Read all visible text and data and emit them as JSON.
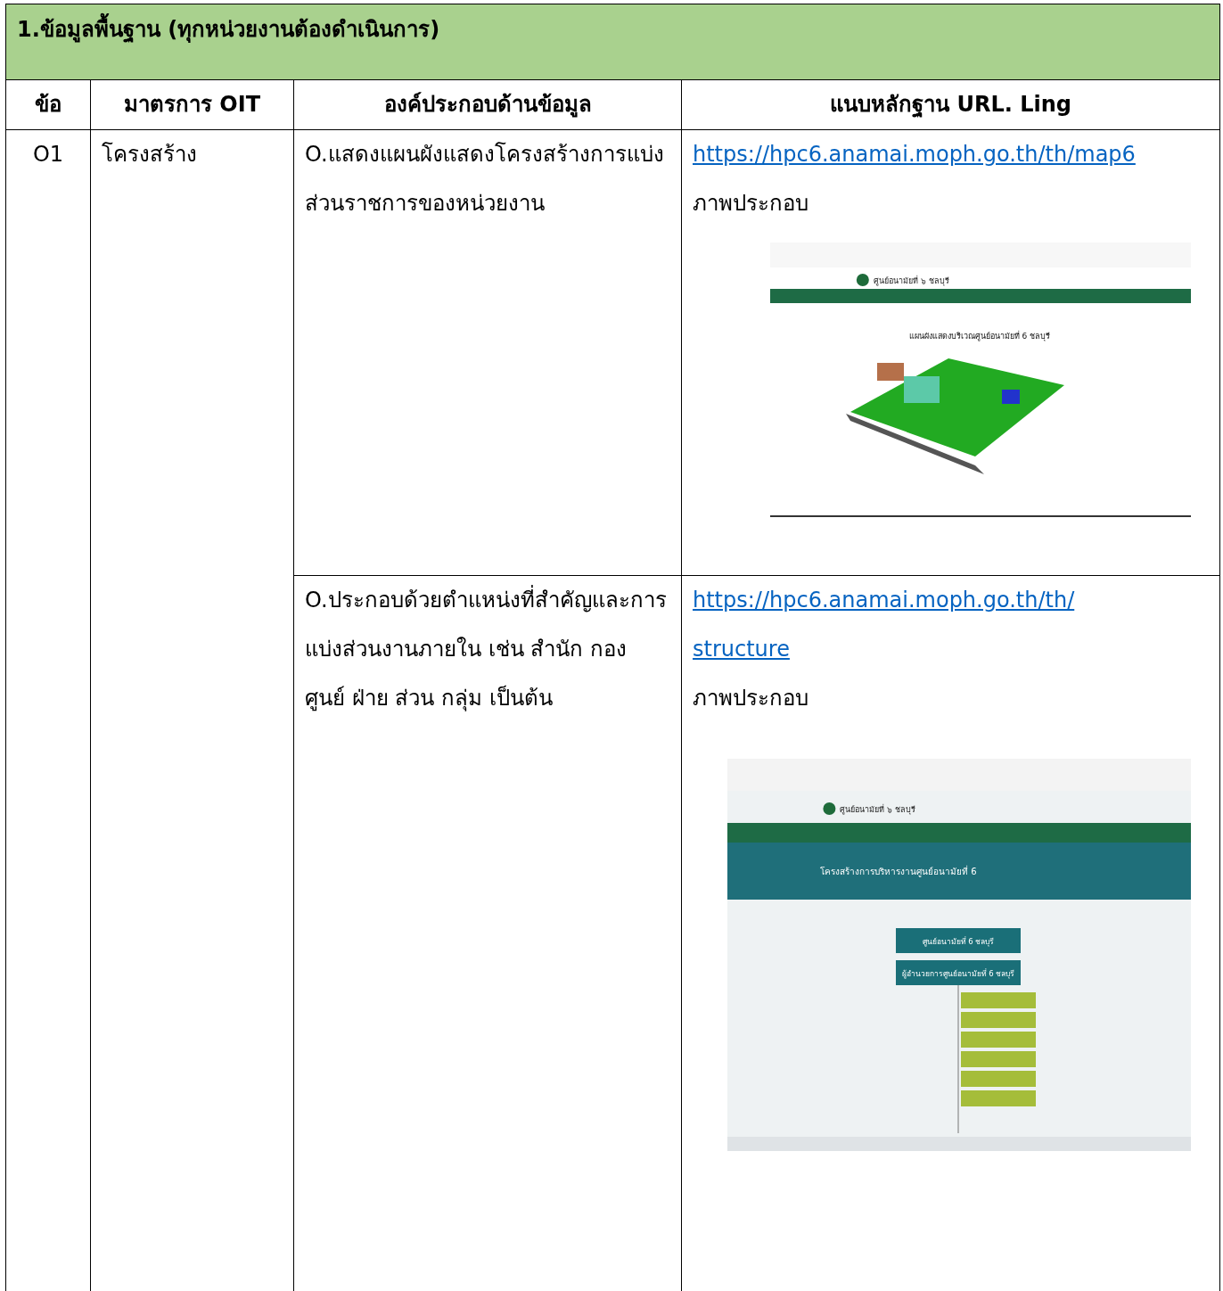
{
  "section_title": "1.ข้อมูลพื้นฐาน (ทุกหน่วยงานต้องดำเนินการ)",
  "table": {
    "columns": [
      "ข้อ",
      "มาตรการ OIT",
      "องค์ประกอบด้านข้อมูล",
      "แนบหลักฐาน URL. Ling"
    ],
    "code": "O1",
    "measure": "โครงสร้าง",
    "rows": [
      {
        "component": "O.แสดงแผนผังแสดงโครงสร้างการแบ่งส่วนราชการของหน่วยงาน",
        "link_lines": [
          "https://hpc6.anamai.moph.go.th/th/map6"
        ],
        "caption": "ภาพประกอบ",
        "screenshot": {
          "kind": "map",
          "site_name": "ศูนย์อนามัยที่ ๖ ชลบุรี",
          "page_title": "แผนผังแสดงบริเวณศูนย์อนามัยที่ 6 ชลบุรี"
        }
      },
      {
        "component": "O.ประกอบด้วยตำแหน่งที่สำคัญและการแบ่งส่วนงานภายใน เช่น สำนัก กอง ศูนย์ ฝ่าย ส่วน กลุ่ม เป็นต้น",
        "link_lines": [
          "https://hpc6.anamai.moph.go.th/th/",
          "structure"
        ],
        "caption": "ภาพประกอบ",
        "screenshot": {
          "kind": "structure",
          "site_name": "ศูนย์อนามัยที่ ๖ ชลบุรี",
          "page_title": "โครงสร้างการบริหารงานศูนย์อนามัยที่ 6",
          "org_boxes": [
            "ศูนย์อนามัยที่ 6 ชลบุรี",
            "ผู้อำนวยการศูนย์อนามัยที่ 6 ชลบุรี"
          ]
        }
      }
    ]
  }
}
